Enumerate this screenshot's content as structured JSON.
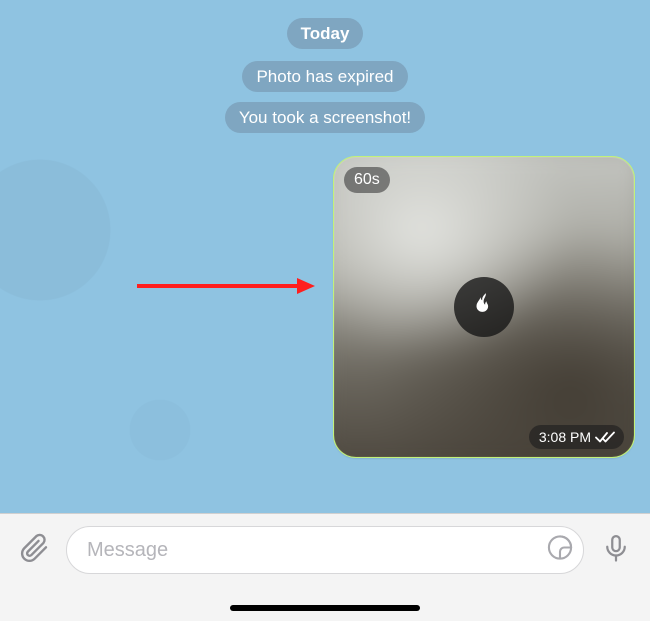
{
  "date_label": "Today",
  "system_messages": [
    "Photo has expired",
    "You took a screenshot!"
  ],
  "photo": {
    "timer_label": "60s",
    "timestamp": "3:08 PM",
    "read_state": "read",
    "center_icon": "flame-icon"
  },
  "composer": {
    "placeholder": "Message"
  },
  "icons": {
    "attach": "paperclip-icon",
    "sticker": "sticker-icon",
    "mic": "mic-icon"
  },
  "colors": {
    "chat_bg": "#8fc3e1",
    "pill_bg": "rgba(120,155,180,0.72)",
    "bubble_outline": "#c2f17a",
    "arrow": "#ff1e1e"
  }
}
